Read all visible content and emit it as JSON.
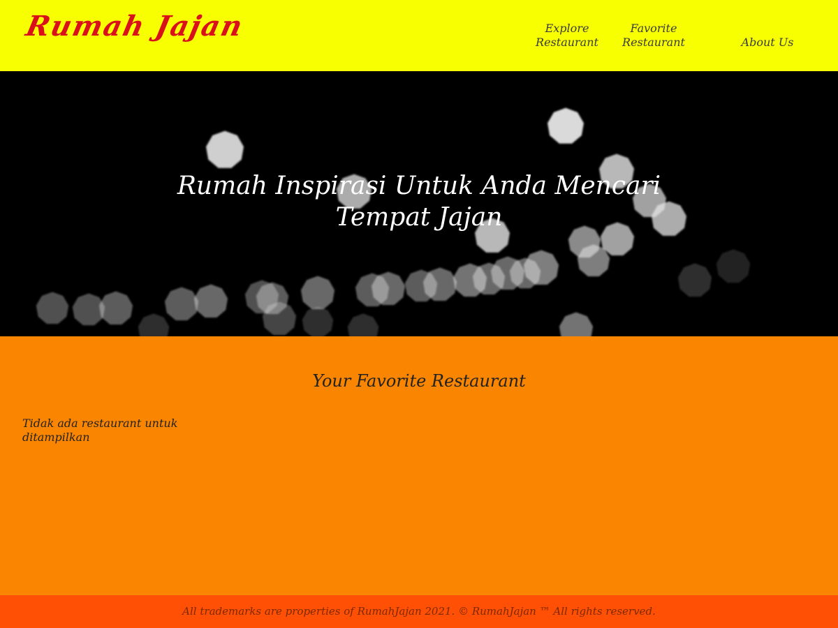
{
  "header": {
    "logo": "Rumah Jajan",
    "nav": [
      {
        "label": "Explore Restaurant"
      },
      {
        "label": "Favorite Restaurant"
      },
      {
        "label": "About Us"
      }
    ],
    "background_color": "#f7ff00",
    "logo_color": "#d8111a"
  },
  "hero": {
    "title": "Rumah Inspirasi Untuk Anda Mencari Tempat Jajan",
    "image": "bokeh-lights-background"
  },
  "main": {
    "title": "Your Favorite Restaurant",
    "empty_message": "Tidak ada restaurant untuk ditampilkan",
    "background_color": "#f98500"
  },
  "footer": {
    "text": "All trademarks are properties of RumahJajan 2021. © RumahJajan ™ All rights reserved.",
    "background_color": "#ff5005"
  }
}
